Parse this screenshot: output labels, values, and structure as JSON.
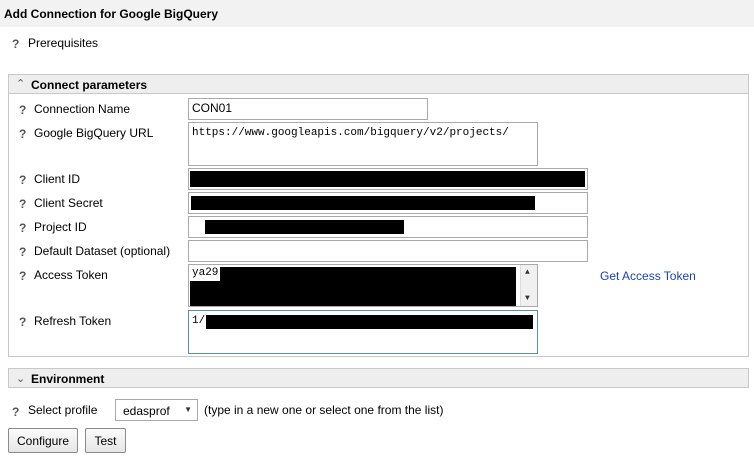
{
  "window": {
    "title": "Add Connection for Google BigQuery"
  },
  "prereq": {
    "help": "?",
    "label": "Prerequisites"
  },
  "connect": {
    "section_title": "Connect parameters",
    "fields": {
      "connection_name": {
        "label": "Connection Name",
        "value": "CON01"
      },
      "bigquery_url": {
        "label": "Google BigQuery URL",
        "value": "https://www.googleapis.com/bigquery/v2/projects/"
      },
      "client_id": {
        "label": "Client ID",
        "value": ""
      },
      "client_secret": {
        "label": "Client Secret",
        "value": ""
      },
      "project_id": {
        "label": "Project ID",
        "value": ""
      },
      "default_dataset": {
        "label": "Default Dataset (optional)",
        "value": ""
      },
      "access_token": {
        "label": "Access Token",
        "value": "ya29"
      },
      "refresh_token": {
        "label": "Refresh Token",
        "value": "1/"
      }
    },
    "get_token_link": "Get Access Token"
  },
  "environment": {
    "section_title": "Environment",
    "profile_label": "Select profile",
    "profile_value": "edasprof",
    "profile_hint": "(type in a new one or select one from the list)"
  },
  "buttons": {
    "configure": "Configure",
    "test": "Test"
  },
  "icons": {
    "collapse": "chevron-up-icon",
    "expand": "chevron-down-icon",
    "help": "question-mark-icon"
  },
  "colors": {
    "link": "#1a3fbf",
    "masked": "#000000"
  }
}
